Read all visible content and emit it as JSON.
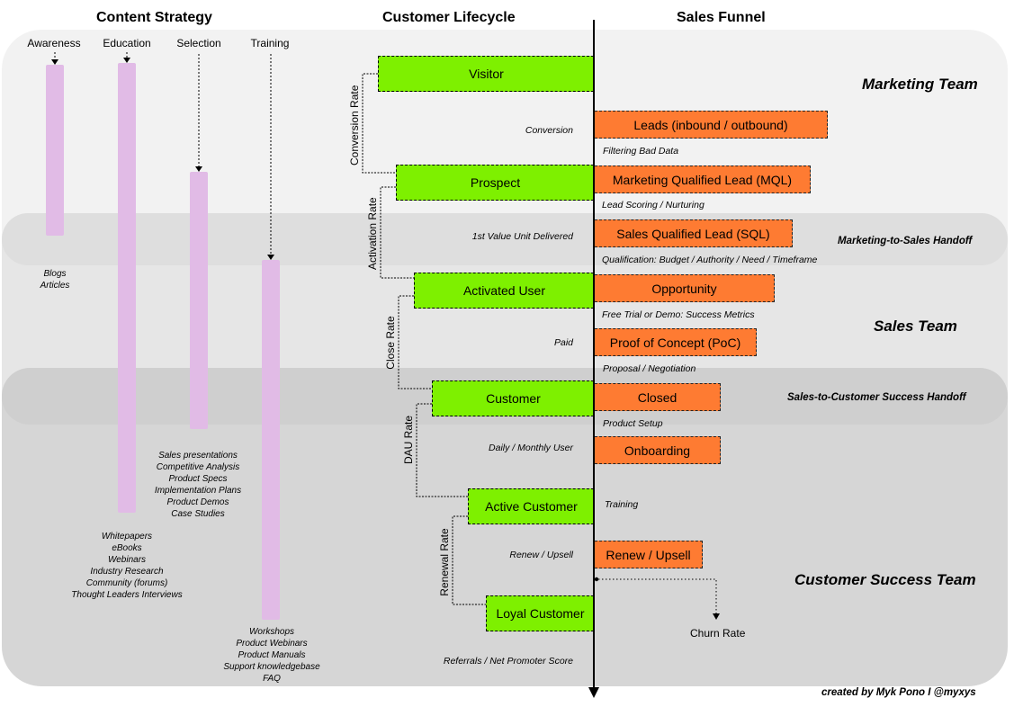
{
  "headers": {
    "content_strategy": "Content Strategy",
    "customer_lifecycle": "Customer Lifecycle",
    "sales_funnel": "Sales Funnel"
  },
  "content_stages": [
    {
      "label": "Awareness",
      "items": [
        "Blogs",
        "Articles"
      ]
    },
    {
      "label": "Education",
      "items": [
        "Whitepapers",
        "eBooks",
        "Webinars",
        "Industry Research",
        "Community (forums)",
        "Thought Leaders Interviews"
      ]
    },
    {
      "label": "Selection",
      "items": [
        "Sales presentations",
        "Competitive Analysis",
        "Product Specs",
        "Implementation Plans",
        "Product Demos",
        "Case Studies"
      ]
    },
    {
      "label": "Training",
      "items": [
        "Workshops",
        "Product Webinars",
        "Product Manuals",
        "Support knowledgebase",
        "FAQ"
      ]
    }
  ],
  "lifecycle": {
    "stages": [
      "Visitor",
      "Prospect",
      "Activated User",
      "Customer",
      "Active Customer",
      "Loyal Customer"
    ],
    "transitions": [
      "Conversion",
      "1st Value Unit Delivered",
      "Paid",
      "Daily / Monthly User",
      "Renew / Upsell",
      "Referrals / Net Promoter Score"
    ],
    "rates": [
      "Conversion Rate",
      "Activation Rate",
      "Close Rate",
      "DAU Rate",
      "Renewal Rate"
    ]
  },
  "funnel": {
    "stages": [
      "Leads (inbound / outbound)",
      "Marketing Qualified Lead (MQL)",
      "Sales Qualified Lead (SQL)",
      "Opportunity",
      "Proof of Concept (PoC)",
      "Closed",
      "Onboarding",
      "Renew / Upsell"
    ],
    "steps": [
      "Filtering Bad Data",
      "Lead Scoring / Nurturing",
      "Qualification: Budget / Authority / Need / Timeframe",
      "Free Trial or Demo: Success Metrics",
      "Proposal / Negotiation",
      "Product Setup",
      "Training"
    ],
    "churn_label": "Churn Rate"
  },
  "teams": {
    "marketing": "Marketing Team",
    "sales": "Sales Team",
    "customer_success": "Customer Success Team",
    "marketing_to_sales": "Marketing-to-Sales Handoff",
    "sales_to_cs": "Sales-to-Customer Success Handoff"
  },
  "colors": {
    "lifecycle_stage": "#7ef000",
    "funnel_stage": "#fe7b32",
    "content_bar": "#e1bbe6"
  },
  "credit": "created by Myk Pono I @myxys"
}
